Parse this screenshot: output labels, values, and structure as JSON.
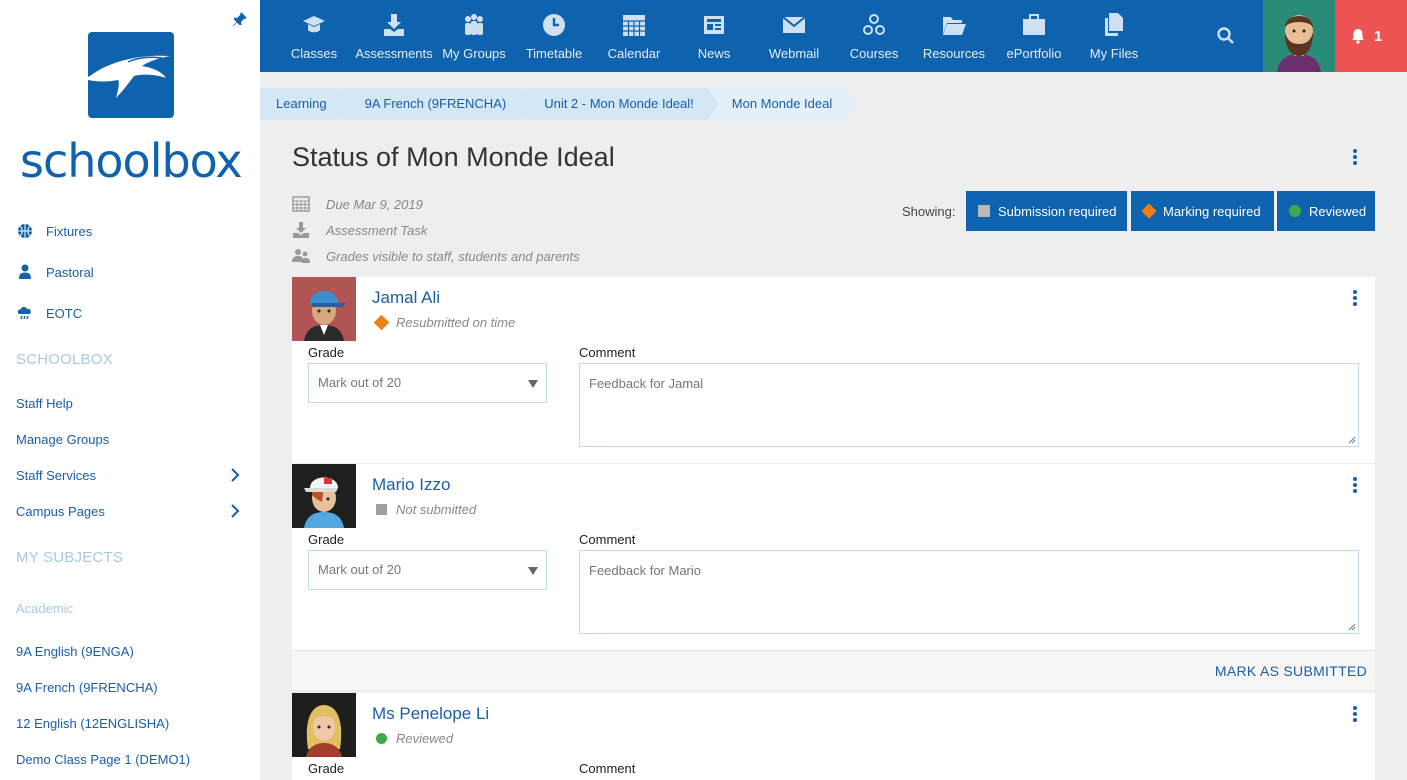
{
  "sidebar": {
    "brand": "schoolbox",
    "quick_links": [
      {
        "label": "Fixtures",
        "icon": "basketball-icon"
      },
      {
        "label": "Pastoral",
        "icon": "person-icon"
      },
      {
        "label": "EOTC",
        "icon": "cloud-rain-icon"
      }
    ],
    "section_schoolbox": "SCHOOLBOX",
    "schoolbox_links": [
      "Staff Help",
      "Manage Groups",
      "Staff Services",
      "Campus Pages"
    ],
    "section_subjects": "MY SUBJECTS",
    "subjects_group": "Academic",
    "subjects": [
      "9A English (9ENGA)",
      "9A French (9FRENCHA)",
      "12 English (12ENGLISHA)",
      "Demo Class Page 1 (DEMO1)"
    ]
  },
  "topnav": {
    "items": [
      "Classes",
      "Assessments",
      "My Groups",
      "Timetable",
      "Calendar",
      "News",
      "Webmail",
      "Courses",
      "Resources",
      "ePortfolio",
      "My Files"
    ],
    "notification_count": "1"
  },
  "breadcrumb": [
    "Learning",
    "9A French (9FRENCHA)",
    "Unit 2 - Mon Monde Ideal!",
    "Mon Monde Ideal"
  ],
  "page": {
    "title": "Status of Mon Monde Ideal",
    "due": "Due Mar 9, 2019",
    "task_type": "Assessment Task",
    "visibility": "Grades visible to staff, students and parents"
  },
  "filters": {
    "showing_label": "Showing:",
    "buttons": [
      "Submission required",
      "Marking required",
      "Reviewed"
    ]
  },
  "labels": {
    "grade": "Grade",
    "comment": "Comment",
    "mark_placeholder": "Mark out of 20",
    "mark_as_submitted": "MARK AS SUBMITTED"
  },
  "students": [
    {
      "name": "Jamal Ali",
      "status": "Resubmitted on time",
      "comment_placeholder": "Feedback for Jamal"
    },
    {
      "name": "Mario Izzo",
      "status": "Not submitted",
      "comment_placeholder": "Feedback for Mario"
    },
    {
      "name": "Ms Penelope Li",
      "status": "Reviewed",
      "comment_placeholder": ""
    }
  ],
  "colors": {
    "brand_blue": "#0f62ad",
    "notification_red": "#ee5353",
    "marking_orange": "#f07f12",
    "reviewed_green": "#3fa94a",
    "not_submitted_grey": "#a0a0a0"
  }
}
